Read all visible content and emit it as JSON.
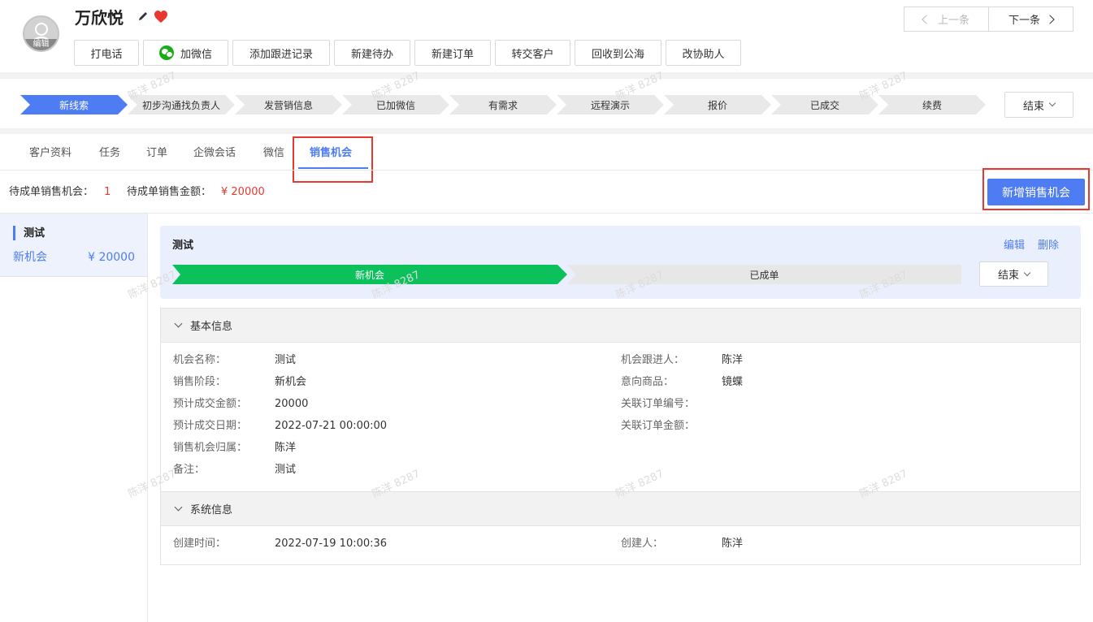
{
  "customer": {
    "name": "万欣悦",
    "avatar_caption": "编辑"
  },
  "actions": [
    {
      "label": "打电话"
    },
    {
      "label": "加微信"
    },
    {
      "label": "添加跟进记录"
    },
    {
      "label": "新建待办"
    },
    {
      "label": "新建订单"
    },
    {
      "label": "转交客户"
    },
    {
      "label": "回收到公海"
    },
    {
      "label": "改协助人"
    }
  ],
  "nav": {
    "prev": "上一条",
    "next": "下一条"
  },
  "stages": [
    {
      "label": "新线索",
      "active": true
    },
    {
      "label": "初步沟通找负责人"
    },
    {
      "label": "发营销信息"
    },
    {
      "label": "已加微信"
    },
    {
      "label": "有需求"
    },
    {
      "label": "远程演示"
    },
    {
      "label": "报价"
    },
    {
      "label": "已成交"
    },
    {
      "label": "续费"
    }
  ],
  "stage_end": "结束",
  "tabs": [
    {
      "label": "客户资料"
    },
    {
      "label": "任务"
    },
    {
      "label": "订单"
    },
    {
      "label": "企微会话"
    },
    {
      "label": "微信"
    },
    {
      "label": "销售机会",
      "active": true
    }
  ],
  "summary": {
    "pending_count_label": "待成单销售机会：",
    "pending_count": "1",
    "pending_amount_label": "待成单销售金额：",
    "pending_amount": "¥ 20000"
  },
  "add_button": "新增销售机会",
  "opportunity_list": [
    {
      "title": "测试",
      "stage": "新机会",
      "amount": "¥ 20000"
    }
  ],
  "detail": {
    "title": "测试",
    "edit": "编辑",
    "delete": "删除",
    "progress": [
      {
        "label": "新机会",
        "active": true
      },
      {
        "label": "已成单"
      }
    ],
    "end": "结束"
  },
  "basic_info": {
    "heading": "基本信息",
    "left": [
      {
        "label": "机会名称：",
        "value": "测试"
      },
      {
        "label": "销售阶段：",
        "value": "新机会"
      },
      {
        "label": "预计成交金额：",
        "value": "20000"
      },
      {
        "label": "预计成交日期：",
        "value": "2022-07-21 00:00:00"
      },
      {
        "label": "销售机会归属：",
        "value": "陈洋"
      },
      {
        "label": "备注：",
        "value": "测试"
      }
    ],
    "right": [
      {
        "label": "机会跟进人：",
        "value": "陈洋"
      },
      {
        "label": "意向商品：",
        "value": "镜蝶"
      },
      {
        "label": "关联订单编号：",
        "value": ""
      },
      {
        "label": "关联订单金额：",
        "value": ""
      }
    ]
  },
  "system_info": {
    "heading": "系统信息",
    "left": [
      {
        "label": "创建时间：",
        "value": "2022-07-19 10:00:36"
      }
    ],
    "right": [
      {
        "label": "创建人：",
        "value": "陈洋"
      }
    ]
  },
  "watermark": "陈洋 8287",
  "colors": {
    "primary": "#4e7cf2",
    "success": "#0cc15c",
    "danger": "#e8382f"
  }
}
